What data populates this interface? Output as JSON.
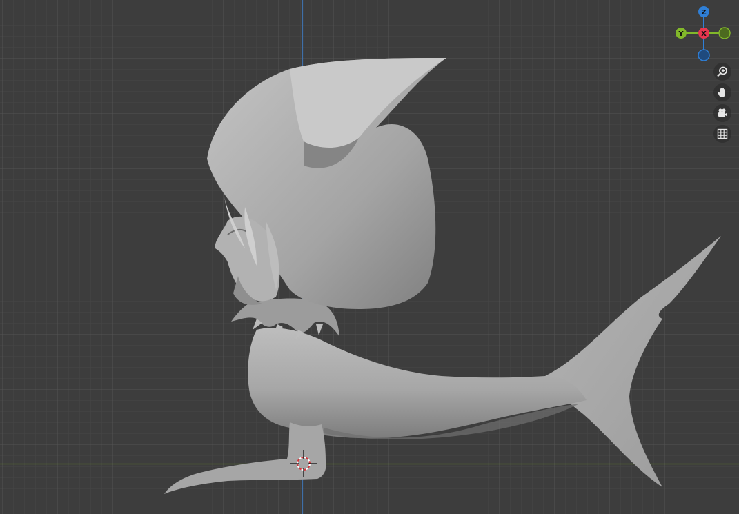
{
  "viewport": {
    "background": "#3d3d3d",
    "grid_minor_color": "#474747",
    "grid_major_color": "#525252",
    "y_axis_color": "#6a8c2a",
    "z_axis_color": "#3f6fa8"
  },
  "gizmo": {
    "axes": [
      {
        "label": "Z",
        "color": "#2f7fd6"
      },
      {
        "label": "Y",
        "color": "#82b82a"
      },
      {
        "label": "X",
        "color": "#e8364f"
      }
    ]
  },
  "nav_buttons": [
    {
      "icon": "zoom-icon"
    },
    {
      "icon": "hand-pan-icon"
    },
    {
      "icon": "camera-icon"
    },
    {
      "icon": "grid-perspective-icon"
    }
  ],
  "model": {
    "description_color": "#a9a9a9"
  }
}
